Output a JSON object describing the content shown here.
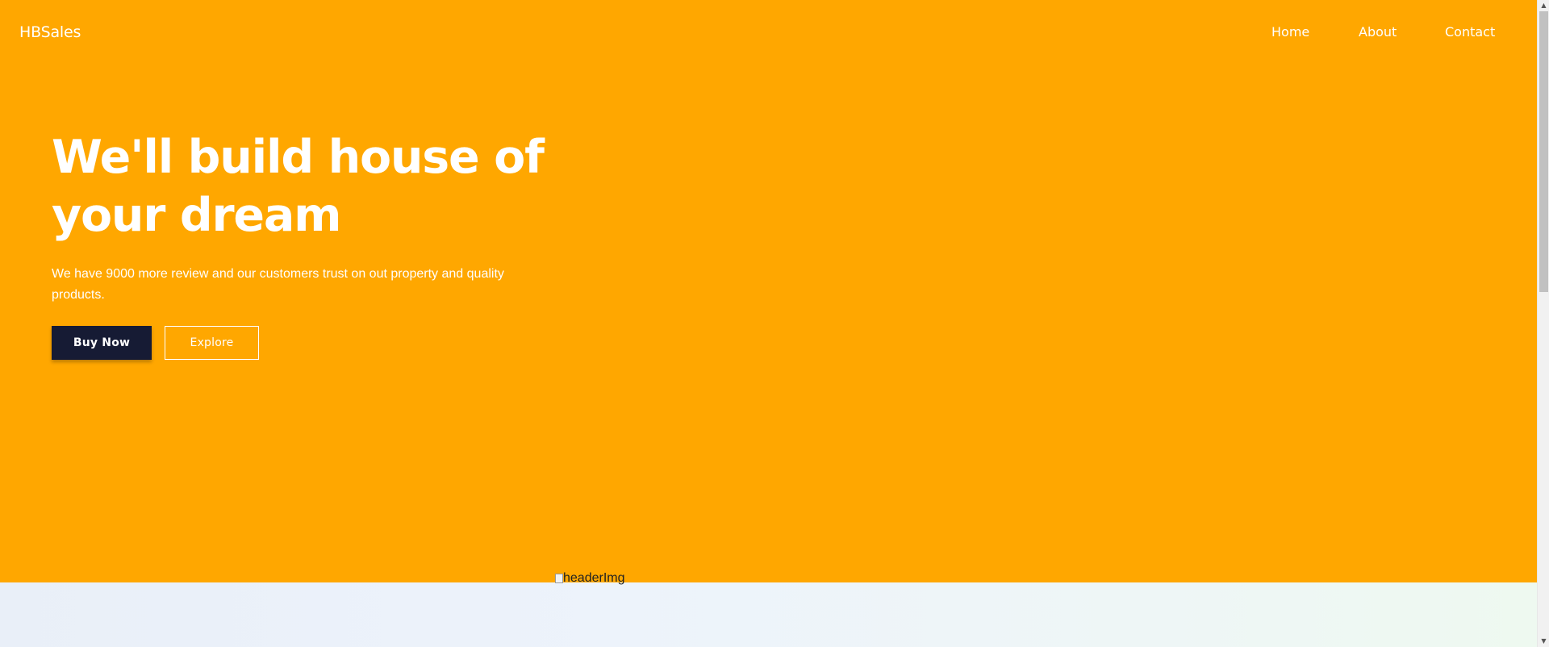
{
  "brand": "HBSales",
  "nav": {
    "home": "Home",
    "about": "About",
    "contact": "Contact"
  },
  "hero": {
    "title": "We'll build house of your dream",
    "description": "We have 9000 more review and our customers trust on out property and quality products.",
    "buy_label": "Buy Now",
    "explore_label": "Explore",
    "image_alt": "headerImg"
  },
  "colors": {
    "hero_background": "#FFA700",
    "buy_button": "#161B34",
    "text_on_hero": "#FFFFFF"
  },
  "icons": {
    "broken_image": "broken-image-icon",
    "scroll_up": "chevron-up-icon",
    "scroll_down": "chevron-down-icon"
  }
}
